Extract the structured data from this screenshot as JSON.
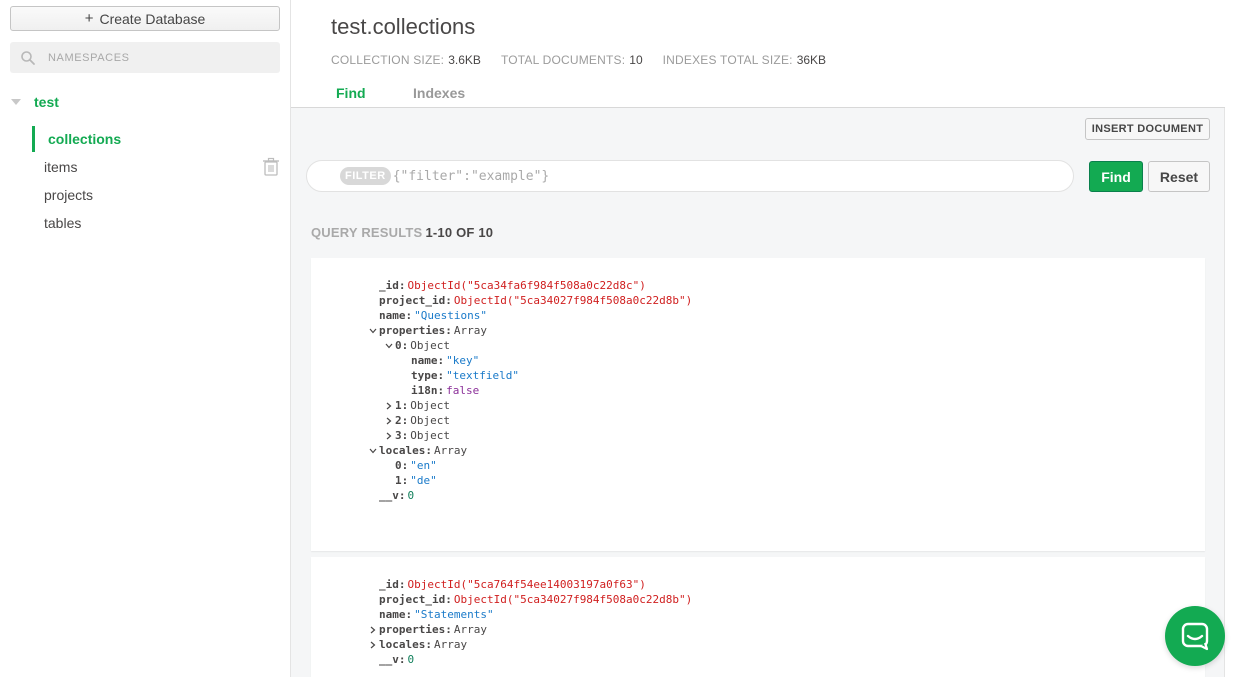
{
  "sidebar": {
    "create_db_label": "Create Database",
    "search_placeholder": "NAMESPACES",
    "database": "test",
    "collections": [
      "collections",
      "items",
      "projects",
      "tables"
    ]
  },
  "header": {
    "title": "test.collections",
    "stats": [
      {
        "key": "COLLECTION SIZE:",
        "value": "3.6KB"
      },
      {
        "key": "TOTAL DOCUMENTS:",
        "value": "10"
      },
      {
        "key": "INDEXES TOTAL SIZE:",
        "value": "36KB"
      }
    ],
    "tabs": [
      "Find",
      "Indexes"
    ]
  },
  "toolbar": {
    "insert_label": "INSERT DOCUMENT",
    "filter_badge": "FILTER",
    "filter_placeholder": "{\"filter\":\"example\"}",
    "find_label": "Find",
    "reset_label": "Reset"
  },
  "results": {
    "label": "QUERY RESULTS",
    "range": "1-10 OF 10"
  },
  "documents": [
    {
      "lines": [
        {
          "depth": 0,
          "expander": "",
          "key": "_id",
          "value": "ObjectId(\"5ca34fa6f984f508a0c22d8c\")",
          "vtype": "oid"
        },
        {
          "depth": 0,
          "expander": "",
          "key": "project_id",
          "value": "ObjectId(\"5ca34027f984f508a0c22d8b\")",
          "vtype": "oid"
        },
        {
          "depth": 0,
          "expander": "",
          "key": "name",
          "value": "\"Questions\"",
          "vtype": "str"
        },
        {
          "depth": 0,
          "expander": "down",
          "key": "properties",
          "value": "Array",
          "vtype": "type"
        },
        {
          "depth": 1,
          "expander": "down",
          "key": "0",
          "value": "Object",
          "vtype": "type"
        },
        {
          "depth": 2,
          "expander": "",
          "key": "name",
          "value": "\"key\"",
          "vtype": "str"
        },
        {
          "depth": 2,
          "expander": "",
          "key": "type",
          "value": "\"textfield\"",
          "vtype": "str"
        },
        {
          "depth": 2,
          "expander": "",
          "key": "i18n",
          "value": "false",
          "vtype": "bool"
        },
        {
          "depth": 1,
          "expander": "right",
          "key": "1",
          "value": "Object",
          "vtype": "type"
        },
        {
          "depth": 1,
          "expander": "right",
          "key": "2",
          "value": "Object",
          "vtype": "type"
        },
        {
          "depth": 1,
          "expander": "right",
          "key": "3",
          "value": "Object",
          "vtype": "type"
        },
        {
          "depth": 0,
          "expander": "down",
          "key": "locales",
          "value": "Array",
          "vtype": "type"
        },
        {
          "depth": 1,
          "expander": "",
          "key": "0",
          "value": "\"en\"",
          "vtype": "str"
        },
        {
          "depth": 1,
          "expander": "",
          "key": "1",
          "value": "\"de\"",
          "vtype": "str"
        },
        {
          "depth": 0,
          "expander": "",
          "key": "__v",
          "value": "0",
          "vtype": "num"
        }
      ]
    },
    {
      "lines": [
        {
          "depth": 0,
          "expander": "",
          "key": "_id",
          "value": "ObjectId(\"5ca764f54ee14003197a0f63\")",
          "vtype": "oid"
        },
        {
          "depth": 0,
          "expander": "",
          "key": "project_id",
          "value": "ObjectId(\"5ca34027f984f508a0c22d8b\")",
          "vtype": "oid"
        },
        {
          "depth": 0,
          "expander": "",
          "key": "name",
          "value": "\"Statements\"",
          "vtype": "str"
        },
        {
          "depth": 0,
          "expander": "right",
          "key": "properties",
          "value": "Array",
          "vtype": "type"
        },
        {
          "depth": 0,
          "expander": "right",
          "key": "locales",
          "value": "Array",
          "vtype": "type"
        },
        {
          "depth": 0,
          "expander": "",
          "key": "__v",
          "value": "0",
          "vtype": "num"
        }
      ]
    }
  ],
  "icons": {
    "search": "search-icon",
    "caret": "caret-down-icon",
    "trash": "trash-icon",
    "chat": "chat-icon"
  },
  "colors": {
    "accent": "#13aa52",
    "oid": "#d01f1f",
    "string": "#1a7ac9",
    "bool": "#8b2f99",
    "number": "#12805c"
  }
}
